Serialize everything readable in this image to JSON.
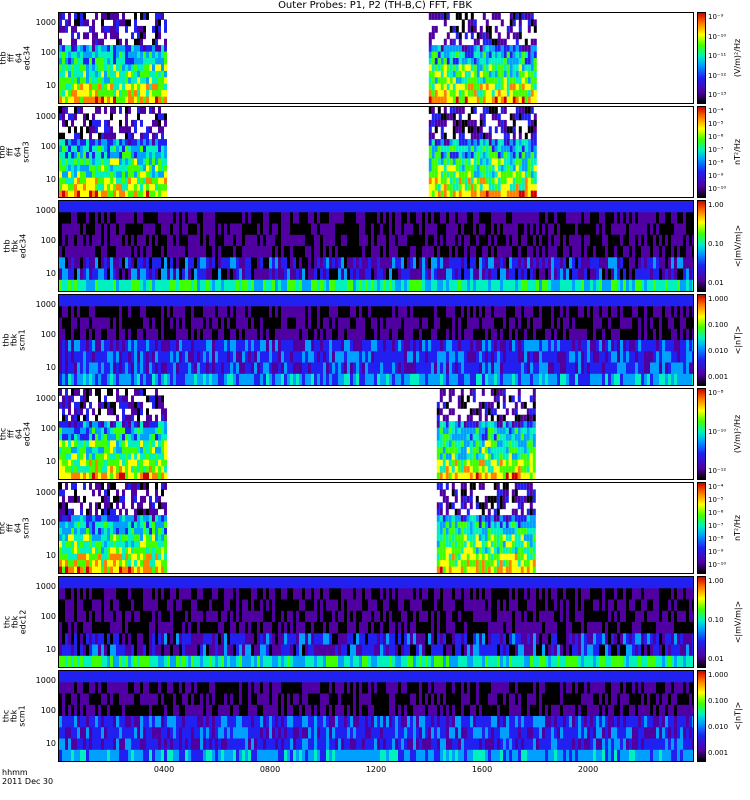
{
  "title": "Outer Probes: P1, P2 (TH-B,C) FFT, FBK",
  "footer": {
    "line1": "hhmm",
    "line2": "2011 Dec 30"
  },
  "colors": {
    "colormap": [
      "#000000",
      "#5000a0",
      "#2020f0",
      "#00a0ff",
      "#00f0c0",
      "#40ff00",
      "#ffff00",
      "#ff8000",
      "#d00000"
    ],
    "background": "#ffffff"
  },
  "chart_data": {
    "type": "heatmap",
    "x_axis": {
      "ticks": [
        "0400",
        "0800",
        "1200",
        "1600",
        "2000"
      ],
      "tick_values_hours": [
        4,
        8,
        12,
        16,
        20
      ],
      "range_hours": [
        0,
        24
      ]
    },
    "panels": [
      {
        "label_lines": [
          "thb",
          "fff",
          "64",
          "edc34"
        ],
        "y_ticks": [
          "1000",
          "100",
          "10"
        ],
        "y_scale": "log",
        "colorbar_ticks": [
          "10⁻⁹",
          "10⁻¹⁰",
          "10⁻¹¹",
          "10⁻¹²",
          "10⁻¹³"
        ],
        "colorbar_unit": "(V/m)²/Hz",
        "coverage_hours": [
          [
            0,
            4
          ],
          [
            14,
            18
          ]
        ]
      },
      {
        "label_lines": [
          "thb",
          "fff",
          "64",
          "scm3"
        ],
        "y_ticks": [
          "1000",
          "100",
          "10"
        ],
        "y_scale": "log",
        "colorbar_ticks": [
          "10⁻⁴",
          "10⁻⁵",
          "10⁻⁶",
          "10⁻⁷",
          "10⁻⁸",
          "10⁻⁹",
          "10⁻¹⁰"
        ],
        "colorbar_unit": "nT²/Hz",
        "coverage_hours": [
          [
            0,
            4
          ],
          [
            14,
            18
          ]
        ]
      },
      {
        "label_lines": [
          "thb",
          "fbk",
          "edc34"
        ],
        "y_ticks": [
          "1000",
          "100",
          "10"
        ],
        "y_scale": "log",
        "colorbar_ticks": [
          "1.00",
          "0.10",
          "0.01"
        ],
        "colorbar_unit": "<|mV/m|>",
        "coverage_hours": [
          [
            0,
            24
          ]
        ]
      },
      {
        "label_lines": [
          "thb",
          "fbk",
          "scm1"
        ],
        "y_ticks": [
          "1000",
          "100",
          "10"
        ],
        "y_scale": "log",
        "colorbar_ticks": [
          "1.000",
          "0.100",
          "0.010",
          "0.001"
        ],
        "colorbar_unit": "<|nT|>",
        "coverage_hours": [
          [
            0,
            24
          ]
        ]
      },
      {
        "label_lines": [
          "thc",
          "fff",
          "64",
          "edc34"
        ],
        "y_ticks": [
          "1000",
          "100",
          "10"
        ],
        "y_scale": "log",
        "colorbar_ticks": [
          "10⁻⁸",
          "10⁻¹⁰",
          "10⁻¹²"
        ],
        "colorbar_unit": "(V/m)²/Hz",
        "coverage_hours": [
          [
            0,
            4
          ],
          [
            14.3,
            18
          ]
        ]
      },
      {
        "label_lines": [
          "thc",
          "fff",
          "64",
          "scm3"
        ],
        "y_ticks": [
          "1000",
          "100",
          "10"
        ],
        "y_scale": "log",
        "colorbar_ticks": [
          "10⁻⁴",
          "10⁻⁵",
          "10⁻⁶",
          "10⁻⁷",
          "10⁻⁸",
          "10⁻⁹",
          "10⁻¹⁰"
        ],
        "colorbar_unit": "nT²/Hz",
        "coverage_hours": [
          [
            0,
            4
          ],
          [
            14.3,
            18
          ]
        ]
      },
      {
        "label_lines": [
          "thc",
          "fbk",
          "edc12"
        ],
        "y_ticks": [
          "1000",
          "100",
          "10"
        ],
        "y_scale": "log",
        "colorbar_ticks": [
          "1.00",
          "0.10",
          "0.01"
        ],
        "colorbar_unit": "<|mV/m|>",
        "coverage_hours": [
          [
            0,
            24
          ]
        ]
      },
      {
        "label_lines": [
          "thc",
          "fbk",
          "scm1"
        ],
        "y_ticks": [
          "1000",
          "100",
          "10"
        ],
        "y_scale": "log",
        "colorbar_ticks": [
          "1.000",
          "0.100",
          "0.010",
          "0.001"
        ],
        "colorbar_unit": "<|nT|>",
        "coverage_hours": [
          [
            0,
            24
          ]
        ]
      }
    ]
  }
}
